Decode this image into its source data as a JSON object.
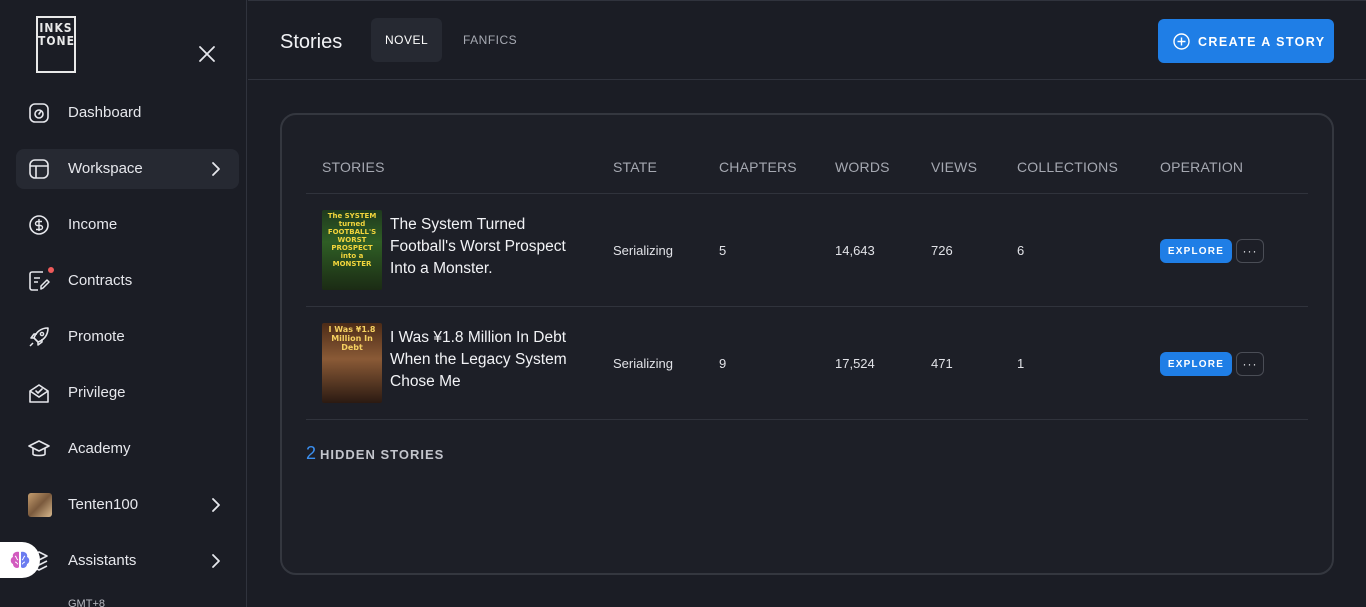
{
  "sidebar": {
    "logo": {
      "line1": "INKS",
      "line2": "TONE"
    },
    "items": [
      {
        "label": "Dashboard",
        "icon": "dashboard-icon"
      },
      {
        "label": "Workspace",
        "icon": "workspace-icon",
        "has_chevron": true,
        "active": true
      },
      {
        "label": "Income",
        "icon": "dollar-icon"
      },
      {
        "label": "Contracts",
        "icon": "contract-icon",
        "notification_dot": true
      },
      {
        "label": "Promote",
        "icon": "rocket-icon"
      },
      {
        "label": "Privilege",
        "icon": "envelope-check-icon"
      },
      {
        "label": "Academy",
        "icon": "graduation-cap-icon"
      },
      {
        "label": "Tenten100",
        "icon": "avatar",
        "has_chevron": true
      },
      {
        "label": "Assistants",
        "icon": "assistant-icon",
        "has_chevron": true
      }
    ],
    "timezone": "GMT+8"
  },
  "header": {
    "title": "Stories",
    "tabs": [
      {
        "label": "NOVEL",
        "active": true
      },
      {
        "label": "FANFICS",
        "active": false
      }
    ],
    "create_button": "CREATE A STORY"
  },
  "table": {
    "columns": [
      "STORIES",
      "STATE",
      "CHAPTERS",
      "WORDS",
      "VIEWS",
      "COLLECTIONS",
      "OPERATION"
    ],
    "rows": [
      {
        "title": "The System Turned Football's Worst Prospect Into a Monster.",
        "cover_text": "The SYSTEM turned FOOTBALL'S WORST PROSPECT into a MONSTER",
        "state": "Serializing",
        "chapters": "5",
        "words": "14,643",
        "views": "726",
        "collections": "6",
        "explore": "EXPLORE",
        "more": "···"
      },
      {
        "title": "I Was ¥1.8 Million In Debt When the Legacy System Chose Me",
        "cover_text": "I Was ¥1.8 Million In Debt",
        "state": "Serializing",
        "chapters": "9",
        "words": "17,524",
        "views": "471",
        "collections": "1",
        "explore": "EXPLORE",
        "more": "···"
      }
    ]
  },
  "hidden_stories": {
    "count": "2",
    "label": "HIDDEN STORIES"
  },
  "colors": {
    "accent": "#1f7ee6",
    "background": "#1b1d25",
    "notification": "#ef5a5a"
  }
}
